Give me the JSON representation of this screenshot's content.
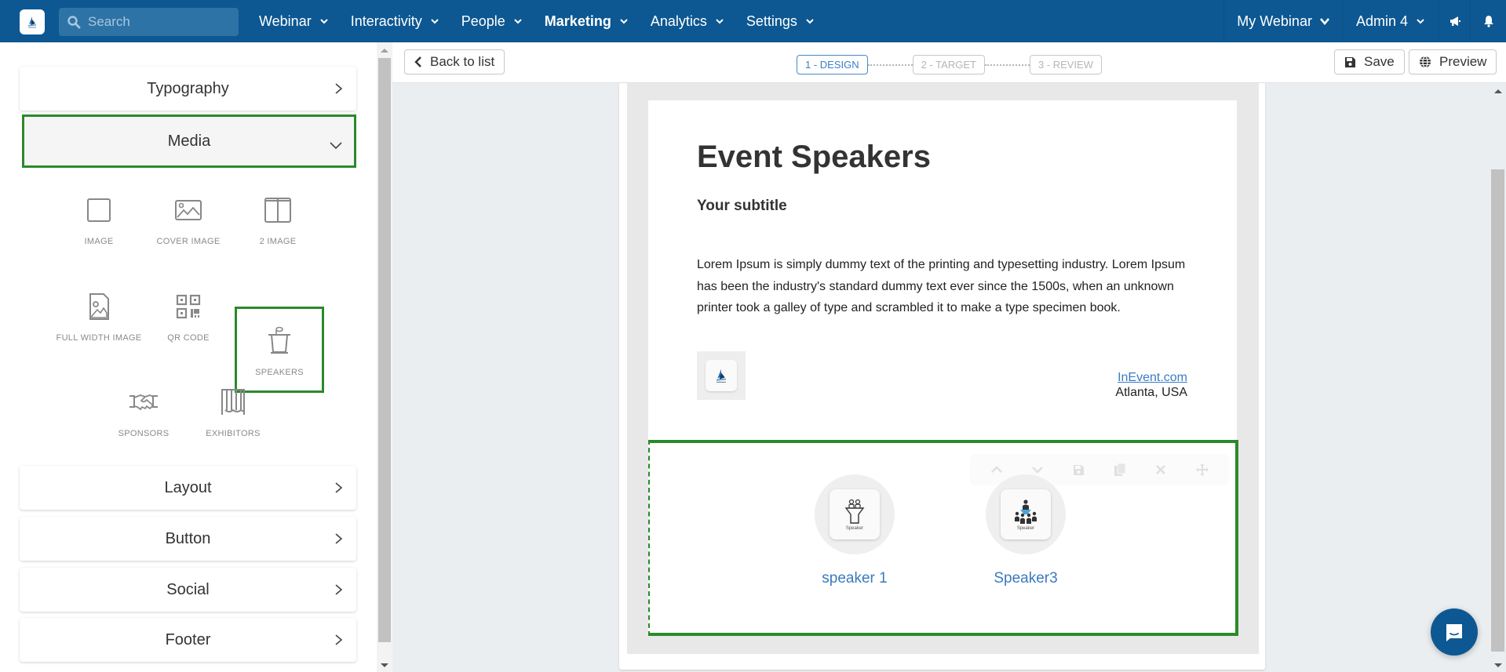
{
  "topbar": {
    "logo_icon": "inevent-logo-icon",
    "search_placeholder": "Search",
    "nav": [
      {
        "label": "Webinar",
        "active": false
      },
      {
        "label": "Interactivity",
        "active": false
      },
      {
        "label": "People",
        "active": false
      },
      {
        "label": "Marketing",
        "active": true
      },
      {
        "label": "Analytics",
        "active": false
      },
      {
        "label": "Settings",
        "active": false
      }
    ],
    "right": {
      "event_label": "My Webinar",
      "user_label": "Admin 4",
      "announcements_icon": "megaphone-icon",
      "notifications_icon": "bell-icon"
    }
  },
  "toolbar": {
    "back_label": "Back to list",
    "steps": [
      {
        "label": "1 - DESIGN",
        "active": true
      },
      {
        "label": "2 - TARGET",
        "active": false
      },
      {
        "label": "3 - REVIEW",
        "active": false
      }
    ],
    "save_label": "Save",
    "preview_label": "Preview"
  },
  "sidebar": {
    "panels_top": [
      {
        "label": "Typography",
        "state": "collapsed"
      },
      {
        "label": "Media",
        "state": "expanded"
      }
    ],
    "media_blocks": [
      {
        "label": "IMAGE",
        "icon": "image-placeholder-icon"
      },
      {
        "label": "COVER IMAGE",
        "icon": "cover-image-icon"
      },
      {
        "label": "2 IMAGE",
        "icon": "two-image-icon"
      },
      {
        "label": "FULL WIDTH IMAGE",
        "icon": "full-width-image-icon"
      },
      {
        "label": "QR CODE",
        "icon": "qr-code-icon"
      },
      {
        "label": "SPEAKERS",
        "icon": "podium-icon",
        "selected": true
      },
      {
        "label": "SPONSORS",
        "icon": "handshake-icon"
      },
      {
        "label": "EXHIBITORS",
        "icon": "booth-icon"
      }
    ],
    "panels_bottom": [
      {
        "label": "Layout"
      },
      {
        "label": "Button"
      },
      {
        "label": "Social"
      },
      {
        "label": "Footer"
      }
    ]
  },
  "email": {
    "title": "Event Speakers",
    "subtitle": "Your subtitle",
    "paragraph": "Lorem Ipsum is simply dummy text of the printing and typesetting industry. Lorem Ipsum has been the industry's standard dummy text ever since the 1500s, when an unknown printer took a galley of type and scrambled it to make a type specimen book.",
    "contact_link": "InEvent.com",
    "contact_location": "Atlanta, USA",
    "speakers": [
      {
        "name": "speaker 1",
        "card_label": "Speaker"
      },
      {
        "name": "Speaker3",
        "card_label": "Speaker"
      }
    ],
    "block_tools": [
      "move-up-icon",
      "move-down-icon",
      "save-block-icon",
      "duplicate-icon",
      "delete-icon",
      "drag-icon"
    ]
  },
  "colors": {
    "header": "#0d5892",
    "selection": "#2a8a2a",
    "link": "#3a7cc5",
    "step_active": "#3b7fc4"
  }
}
